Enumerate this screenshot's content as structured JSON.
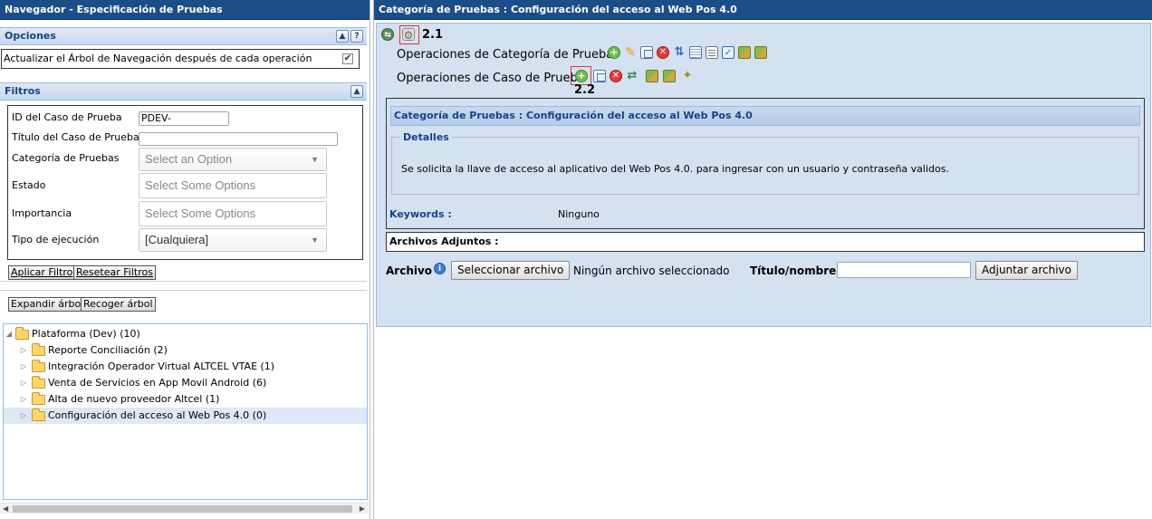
{
  "left": {
    "title": "Navegador - Especificación de Pruebas",
    "options": {
      "header": "Opciones",
      "checkbox_label": "Actualizar el Árbol de Navegación después de cada operación",
      "checked": true
    },
    "filters": {
      "header": "Filtros",
      "testcase_id_label": "ID del Caso de Prueba",
      "testcase_id_value": "PDEV-",
      "testcase_title_label": "Título del Caso de Prueba",
      "testcase_title_value": "",
      "category_label": "Categoría de Pruebas",
      "category_placeholder": "Select an Option",
      "status_label": "Estado",
      "status_placeholder": "Select Some Options",
      "importance_label": "Importancia",
      "importance_placeholder": "Select Some Options",
      "exec_type_label": "Tipo de ejecución",
      "exec_type_value": "[Cualquiera]",
      "apply_button": "Aplicar Filtro",
      "reset_button": "Resetear Filtros"
    },
    "tree_controls": {
      "expand_button": "Expandir árbol",
      "collapse_button": "Recoger árbol"
    },
    "tree": {
      "root": "Plataforma (Dev) (10)",
      "children": [
        "Reporte Conciliación (2)",
        "Integración Operador Virtual ALTCEL VTAE (1)",
        "Venta de Servicios en App Movil Android (6)",
        "Alta de nuevo proveedor Altcel (1)",
        "Configuración del acceso al Web Pos 4.0 (0)"
      ],
      "selected_index": 4
    }
  },
  "right": {
    "title": "Categoría de Pruebas : Configuración del acceso al Web Pos 4.0",
    "callout_settings": "2.1",
    "callout_add": "2.2",
    "category_ops_label": "Operaciones de Categoría de Pruebas",
    "testcase_ops_label": "Operaciones de Caso de Prueba",
    "panel": {
      "header": "Categoría de Pruebas : Configuración del acceso al Web Pos 4.0",
      "details_legend": "Detalles",
      "summary": "Se solicita la llave de acceso al aplicativo del Web Pos 4.0. para ingresar con un usuario y contraseña validos.",
      "keywords_label": "Keywords :",
      "keywords_value": "Ninguno"
    },
    "attachments": {
      "header": "Archivos Adjuntos :",
      "file_label": "Archivo",
      "select_file_button": "Seleccionar archivo",
      "no_file_text": "Ningún archivo seleccionado",
      "title_label": "Título/nombre:",
      "title_value": "",
      "attach_button": "Adjuntar archivo"
    }
  },
  "colors": {
    "titlebar": "#1b4e89",
    "panel_bg": "#d3e1f1",
    "header_text": "#15428b",
    "highlight_box": "#e53333"
  }
}
